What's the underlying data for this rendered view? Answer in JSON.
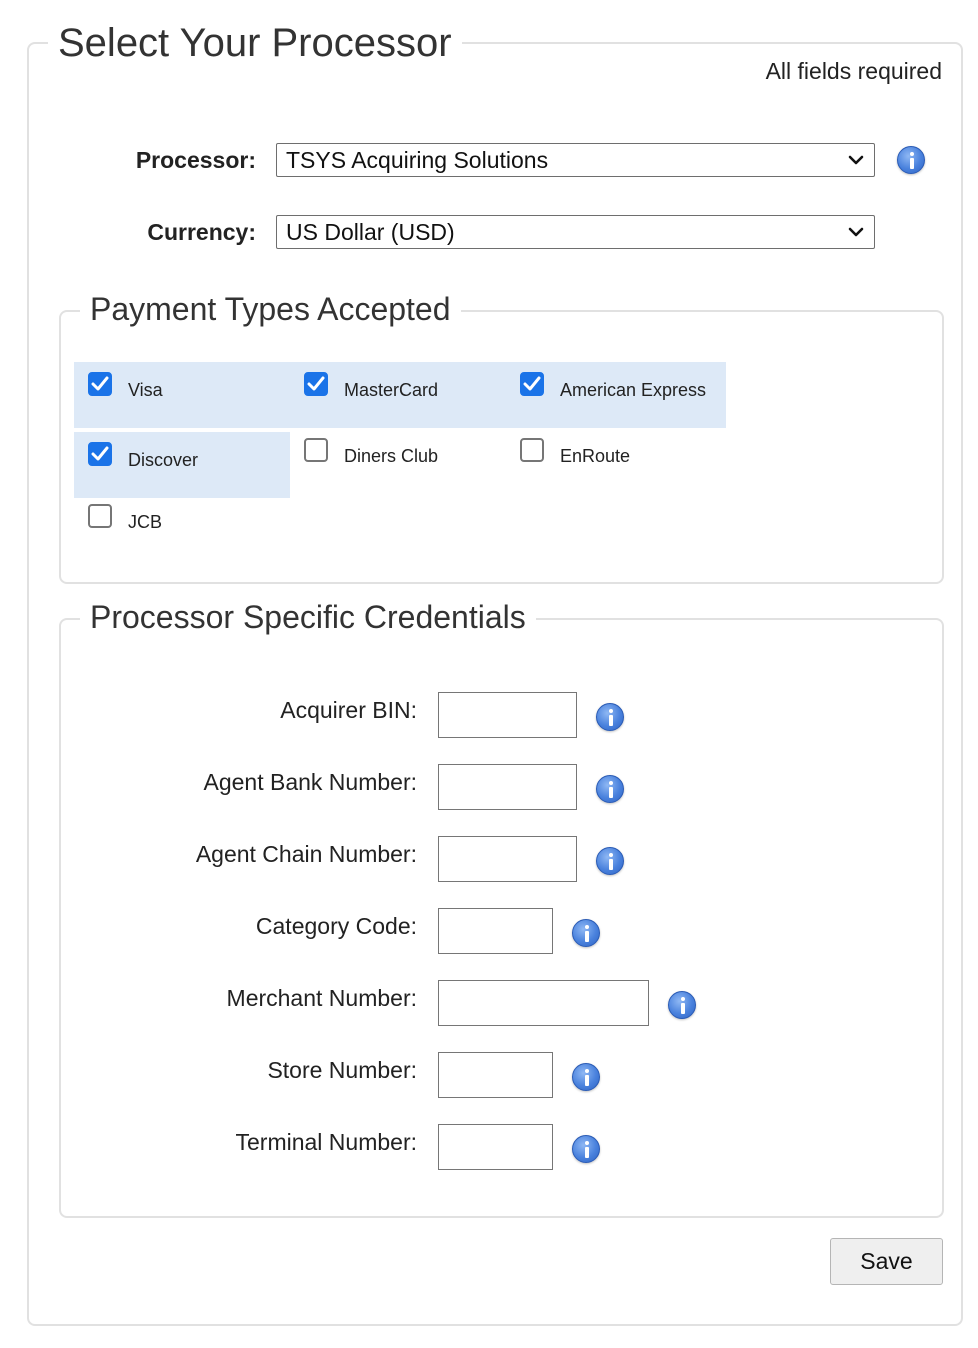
{
  "title": "Select Your Processor",
  "required_note": "All fields required",
  "processor": {
    "label": "Processor:",
    "value": "TSYS Acquiring Solutions"
  },
  "currency": {
    "label": "Currency:",
    "value": "US Dollar (USD)"
  },
  "payment_types": {
    "title": "Payment Types Accepted",
    "items": [
      {
        "label": "Visa",
        "checked": true
      },
      {
        "label": "MasterCard",
        "checked": true
      },
      {
        "label": "American Express",
        "checked": true
      },
      {
        "label": "Discover",
        "checked": true
      },
      {
        "label": "Diners Club",
        "checked": false
      },
      {
        "label": "EnRoute",
        "checked": false
      },
      {
        "label": "JCB",
        "checked": false
      }
    ]
  },
  "credentials": {
    "title": "Processor Specific Credentials",
    "fields": [
      {
        "label": "Acquirer BIN:",
        "value": ""
      },
      {
        "label": "Agent Bank Number:",
        "value": ""
      },
      {
        "label": "Agent Chain Number:",
        "value": ""
      },
      {
        "label": "Category Code:",
        "value": ""
      },
      {
        "label": "Merchant Number:",
        "value": ""
      },
      {
        "label": "Store Number:",
        "value": ""
      },
      {
        "label": "Terminal Number:",
        "value": ""
      }
    ]
  },
  "actions": {
    "save_label": "Save"
  },
  "colors": {
    "checked_cell_bg": "#dde9f7",
    "checkbox_on": "#1a73e8",
    "info_icon": "#4a82dd"
  }
}
